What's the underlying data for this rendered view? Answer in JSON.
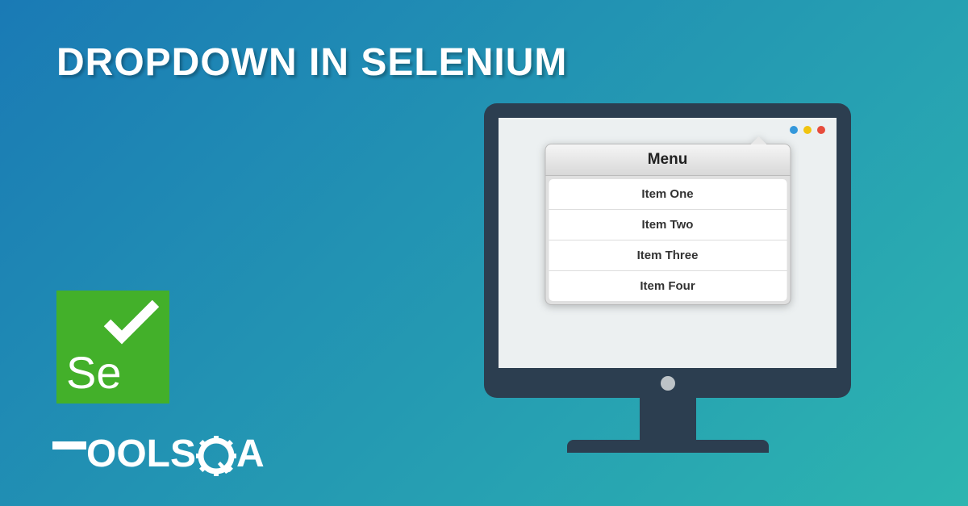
{
  "title": "DROPDOWN IN SELENIUM",
  "selenium": {
    "text": "Se"
  },
  "toolsqa": {
    "part1": "OOLS",
    "part2": "A"
  },
  "menu": {
    "header": "Menu",
    "items": [
      "Item One",
      "Item Two",
      "Item Three",
      "Item Four"
    ]
  }
}
